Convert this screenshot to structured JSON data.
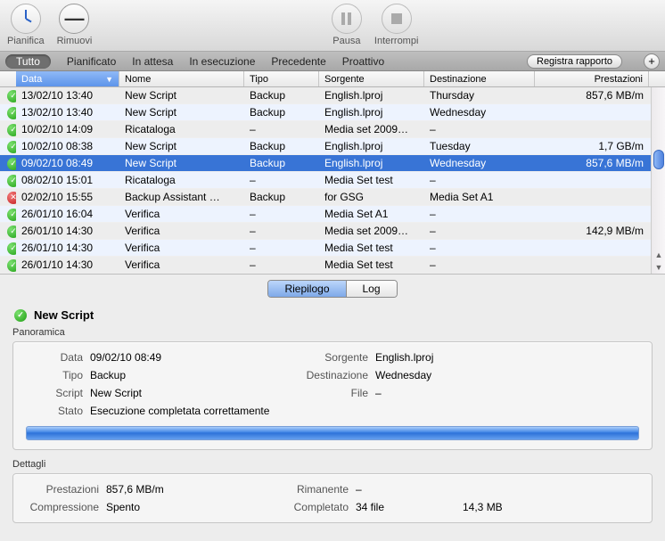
{
  "toolbar": {
    "pianifica": "Pianifica",
    "rimuovi": "Rimuovi",
    "pausa": "Pausa",
    "interrompi": "Interrompi"
  },
  "filters": {
    "tutto": "Tutto",
    "pianificato": "Pianificato",
    "in_attesa": "In attesa",
    "in_esecuzione": "In esecuzione",
    "precedente": "Precedente",
    "proattivo": "Proattivo",
    "registra": "Registra rapporto",
    "plus": "+"
  },
  "columns": {
    "data": "Data",
    "nome": "Nome",
    "tipo": "Tipo",
    "sorgente": "Sorgente",
    "destinazione": "Destinazione",
    "prestazioni": "Prestazioni"
  },
  "rows": [
    {
      "status": "ok",
      "data": "13/02/10 13:40",
      "nome": "New Script",
      "tipo": "Backup",
      "sorg": "English.lproj",
      "dest": "Thursday",
      "prest": "857,6 MB/m"
    },
    {
      "status": "ok",
      "data": "13/02/10 13:40",
      "nome": "New Script",
      "tipo": "Backup",
      "sorg": "English.lproj",
      "dest": "Wednesday",
      "prest": ""
    },
    {
      "status": "ok",
      "data": "10/02/10 14:09",
      "nome": "Ricataloga",
      "tipo": "–",
      "sorg": "Media set 2009…",
      "dest": "–",
      "prest": ""
    },
    {
      "status": "ok",
      "data": "10/02/10 08:38",
      "nome": "New Script",
      "tipo": "Backup",
      "sorg": "English.lproj",
      "dest": "Tuesday",
      "prest": "1,7 GB/m"
    },
    {
      "status": "ok",
      "data": "09/02/10 08:49",
      "nome": "New Script",
      "tipo": "Backup",
      "sorg": "English.lproj",
      "dest": "Wednesday",
      "prest": "857,6 MB/m",
      "selected": true
    },
    {
      "status": "ok",
      "data": "08/02/10 15:01",
      "nome": "Ricataloga",
      "tipo": "–",
      "sorg": "Media Set test",
      "dest": "–",
      "prest": ""
    },
    {
      "status": "err",
      "data": "02/02/10 15:55",
      "nome": "Backup Assistant …",
      "tipo": "Backup",
      "sorg": "for GSG",
      "dest": "Media Set A1",
      "prest": ""
    },
    {
      "status": "ok",
      "data": "26/01/10 16:04",
      "nome": "Verifica",
      "tipo": "–",
      "sorg": "Media Set A1",
      "dest": "–",
      "prest": ""
    },
    {
      "status": "ok",
      "data": "26/01/10 14:30",
      "nome": "Verifica",
      "tipo": "–",
      "sorg": "Media set 2009…",
      "dest": "–",
      "prest": "142,9 MB/m"
    },
    {
      "status": "ok",
      "data": "26/01/10 14:30",
      "nome": "Verifica",
      "tipo": "–",
      "sorg": "Media Set test",
      "dest": "–",
      "prest": ""
    },
    {
      "status": "ok",
      "data": "26/01/10 14:30",
      "nome": "Verifica",
      "tipo": "–",
      "sorg": "Media Set test",
      "dest": "–",
      "prest": ""
    }
  ],
  "tabs": {
    "riepilogo": "Riepilogo",
    "log": "Log"
  },
  "detail": {
    "title": "New Script",
    "panoramica_label": "Panoramica",
    "dettagli_label": "Dettagli",
    "labels": {
      "data": "Data",
      "tipo": "Tipo",
      "script": "Script",
      "stato": "Stato",
      "sorgente": "Sorgente",
      "destinazione": "Destinazione",
      "file": "File",
      "prestazioni": "Prestazioni",
      "rimanente": "Rimanente",
      "compressione": "Compressione",
      "completato": "Completato"
    },
    "values": {
      "data": "09/02/10 08:49",
      "tipo": "Backup",
      "script": "New Script",
      "stato": "Esecuzione completata correttamente",
      "sorgente": "English.lproj",
      "destinazione": "Wednesday",
      "file": "–",
      "prestazioni": "857,6 MB/m",
      "rimanente": "–",
      "compressione": "Spento",
      "completato_files": "34 file",
      "completato_size": "14,3 MB"
    }
  }
}
